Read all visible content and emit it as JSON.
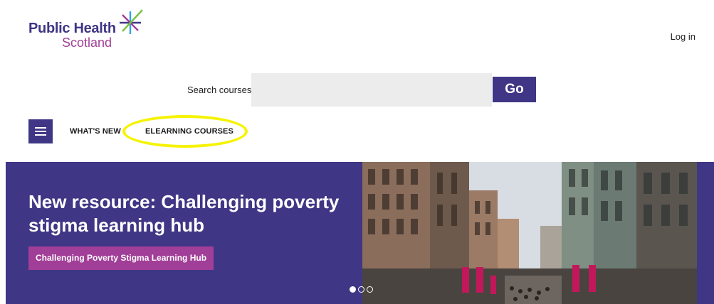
{
  "header": {
    "logo": {
      "line1": "Public Health",
      "line2": "Scotland"
    },
    "login_label": "Log in"
  },
  "search": {
    "label": "Search courses",
    "value": "",
    "placeholder": "",
    "button_label": "Go"
  },
  "nav": {
    "menu_icon": "hamburger-menu-icon",
    "items": [
      {
        "label": "WHAT'S NEW"
      },
      {
        "label": "ELEARNING COURSES",
        "highlighted": true
      }
    ]
  },
  "hero": {
    "title": "New resource: Challenging poverty stigma learning hub",
    "button_label": "Challenging Poverty Stigma Learning Hub",
    "slides_total": 3,
    "active_slide": 1
  },
  "colors": {
    "brand_purple": "#3f3685",
    "brand_magenta": "#a13e97",
    "logo_green": "#7ac143",
    "highlight_yellow": "#f5f300",
    "search_bg": "#ececec"
  }
}
